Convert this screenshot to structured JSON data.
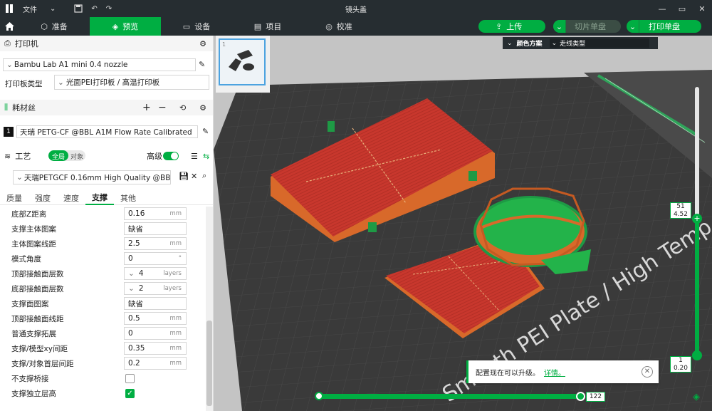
{
  "titlebar": {
    "file_menu": "文件",
    "title": "镜头盖"
  },
  "tabs": [
    {
      "label": "准备"
    },
    {
      "label": "预览"
    },
    {
      "label": "设备"
    },
    {
      "label": "项目"
    },
    {
      "label": "校准"
    }
  ],
  "actions": {
    "upload": "上传",
    "slice": "切片单盘",
    "print": "打印单盘"
  },
  "printer": {
    "section": "打印机",
    "model": "Bambu Lab A1 mini 0.4 nozzle",
    "plate_label": "打印板类型",
    "plate_value": "光面PEI打印板 / 高温打印板"
  },
  "filament": {
    "section": "耗材丝",
    "slot": "1",
    "name": "天瑞 PETG-CF @BBL A1M Flow Rate Calibrated"
  },
  "process": {
    "section": "工艺",
    "toggle_global": "全局",
    "toggle_object": "对象",
    "advanced_label": "高级",
    "advanced_on": true,
    "preset": "天瑞PETGCF 0.16mm High Quality @BB..."
  },
  "subtabs": [
    "质量",
    "强度",
    "速度",
    "支撑",
    "其他"
  ],
  "active_subtab": "支撑",
  "params": [
    {
      "label": "底部Z距离",
      "value": "0.16",
      "unit": "mm"
    },
    {
      "label": "支撑主体图案",
      "value": "缺省",
      "unit": ""
    },
    {
      "label": "主体图案线距",
      "value": "2.5",
      "unit": "mm"
    },
    {
      "label": "模式角度",
      "value": "0",
      "unit": "°"
    },
    {
      "label": "顶部接触面层数",
      "value": "4",
      "unit": "layers"
    },
    {
      "label": "底部接触面层数",
      "value": "2",
      "unit": "layers"
    },
    {
      "label": "支撑面图案",
      "value": "缺省",
      "unit": ""
    },
    {
      "label": "顶部接触面线距",
      "value": "0.5",
      "unit": "mm"
    },
    {
      "label": "普通支撑拓展",
      "value": "0",
      "unit": "mm"
    },
    {
      "label": "支撑/模型xy间距",
      "value": "0.35",
      "unit": "mm"
    },
    {
      "label": "支撑/对象首层间距",
      "value": "0.2",
      "unit": "mm"
    },
    {
      "label": "不支撑桥接",
      "checked": false
    },
    {
      "label": "支撑独立层高",
      "checked": true
    }
  ],
  "viewport": {
    "plate_number": "1",
    "color_scheme_label": "颜色方案",
    "color_scheme_value": "走线类型",
    "plate_text": "Smooth PEI Plate / High Temp Plate",
    "layer_top": "51",
    "layer_top_height": "4.52",
    "layer_bottom": "1",
    "layer_bottom_height": "0.20",
    "move_value": "122",
    "notification": "配置现在可以升级。",
    "notification_link": "详情。"
  },
  "colors": {
    "accent": "#00ae42",
    "dark_bar": "#262d31",
    "model_red": "#c8372d",
    "model_orange": "#d8692a",
    "support_green": "#23b34a"
  }
}
